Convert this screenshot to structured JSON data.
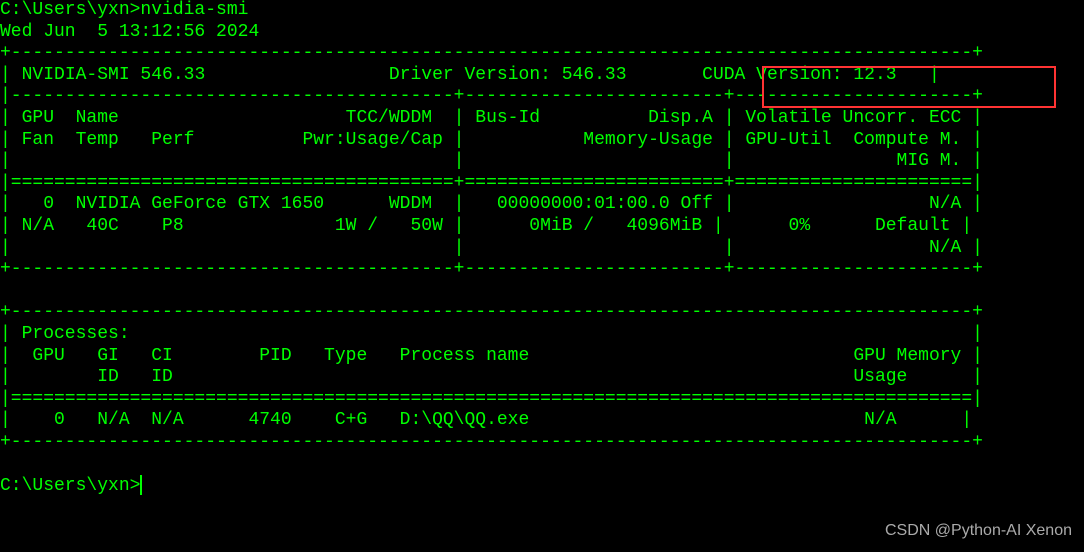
{
  "prompt_line": "C:\\Users\\yxn>nvidia-smi",
  "timestamp": "Wed Jun  5 13:12:56 2024",
  "top_border": "+-----------------------------------------------------------------------------------------+",
  "smi_version": "NVIDIA-SMI 546.33",
  "driver_version": "Driver Version: 546.33",
  "cuda_version": "CUDA Version: 12.3",
  "header_row1": "| GPU  Name                     TCC/WDDM  | Bus-Id          Disp.A | Volatile Uncorr. ECC |",
  "header_row2": "| Fan  Temp   Perf          Pwr:Usage/Cap |           Memory-Usage | GPU-Util  Compute M. |",
  "header_row3": "|                                         |                        |               MIG M. |",
  "divider_eq": "|=========================================+========================+======================|",
  "gpu_row1": "|   0  NVIDIA GeForce GTX 1650      WDDM  |   00000000:01:00.0 Off |                  N/A |",
  "gpu_row2": "| N/A   40C    P8              1W /   50W |      0MiB /   4096MiB |      0%      Default |",
  "gpu_row3": "|                                         |                        |                  N/A |",
  "mid_border": "+-----------------------------------------+------------------------+----------------------+",
  "blank": "",
  "proc_top": "+-----------------------------------------------------------------------------------------+",
  "proc_title": "| Processes:                                                                              |",
  "proc_h1": "|  GPU   GI   CI        PID   Type   Process name                              GPU Memory |",
  "proc_h2": "|        ID   ID                                                               Usage      |",
  "proc_div": "|=========================================================================================|",
  "proc_row": "|    0   N/A  N/A      4740    C+G   D:\\QQ\\QQ.exe                               N/A      |",
  "proc_bot": "+-----------------------------------------------------------------------------------------+",
  "prompt_end": "C:\\Users\\yxn>",
  "watermark": "CSDN @Python-AI Xenon",
  "info_row_prefix": "| ",
  "info_row_mid1": "                 ",
  "info_row_mid2": "       ",
  "info_row_suffix": "   |",
  "header_divider": "|-----------------------------------------+------------------------+----------------------+"
}
